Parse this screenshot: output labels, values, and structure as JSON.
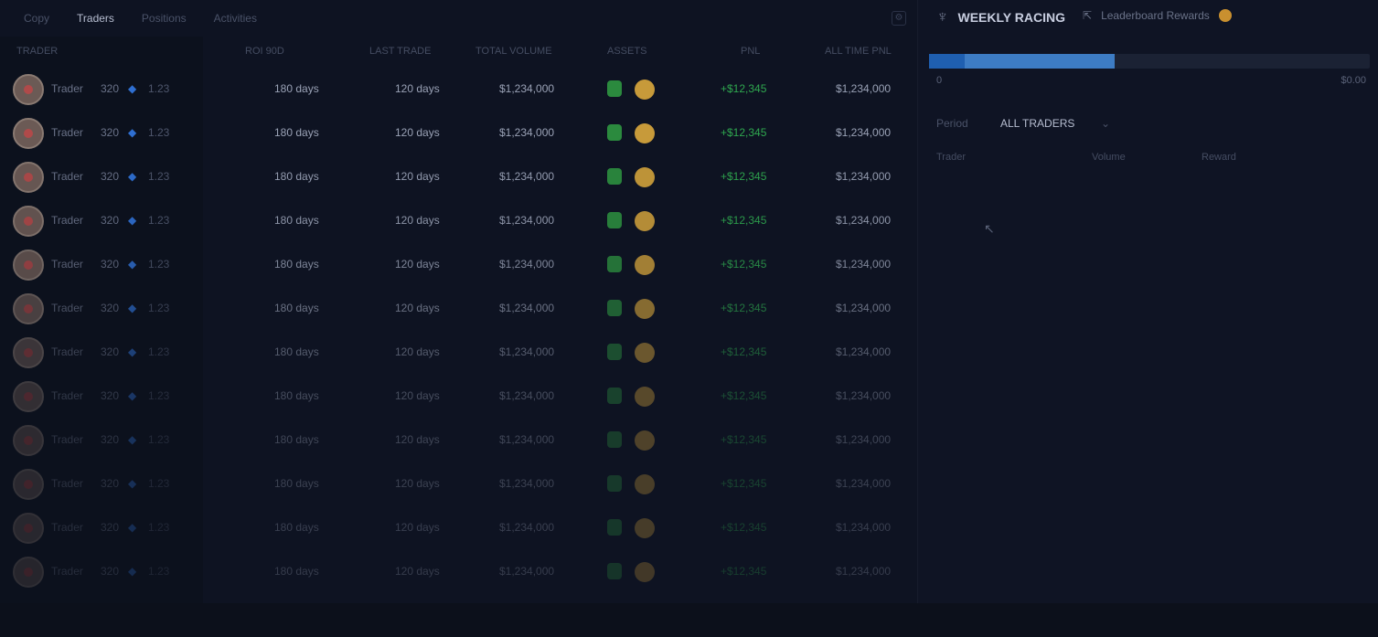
{
  "nav": {
    "tabs": [
      "Copy",
      "Traders",
      "Positions",
      "Activities"
    ],
    "active_index": 1
  },
  "table": {
    "headers": [
      "TRADER",
      "ROI 90D",
      "LAST TRADE",
      "TOTAL VOLUME",
      "ASSETS",
      "PNL",
      "ALL TIME PNL"
    ],
    "rows": [
      {
        "name": "Trader",
        "level": "320",
        "value": "1.23",
        "roi": "180 days",
        "last": "120 days",
        "volume": "$1,234,000",
        "pnl": "+$12,345",
        "alltime": "$1,234,000",
        "opacity": 1
      },
      {
        "name": "Trader",
        "level": "320",
        "value": "1.23",
        "roi": "180 days",
        "last": "120 days",
        "volume": "$1,234,000",
        "pnl": "+$12,345",
        "alltime": "$1,234,000",
        "opacity": 1
      },
      {
        "name": "Trader",
        "level": "320",
        "value": "1.23",
        "roi": "180 days",
        "last": "120 days",
        "volume": "$1,234,000",
        "pnl": "+$12,345",
        "alltime": "$1,234,000",
        "opacity": 0.95
      },
      {
        "name": "Trader",
        "level": "320",
        "value": "1.23",
        "roi": "180 days",
        "last": "120 days",
        "volume": "$1,234,000",
        "pnl": "+$12,345",
        "alltime": "$1,234,000",
        "opacity": 0.9
      },
      {
        "name": "Trader",
        "level": "320",
        "value": "1.23",
        "roi": "180 days",
        "last": "120 days",
        "volume": "$1,234,000",
        "pnl": "+$12,345",
        "alltime": "$1,234,000",
        "opacity": 0.8
      },
      {
        "name": "Trader",
        "level": "320",
        "value": "1.23",
        "roi": "180 days",
        "last": "120 days",
        "volume": "$1,234,000",
        "pnl": "+$12,345",
        "alltime": "$1,234,000",
        "opacity": 0.65
      },
      {
        "name": "Trader",
        "level": "320",
        "value": "1.23",
        "roi": "180 days",
        "last": "120 days",
        "volume": "$1,234,000",
        "pnl": "+$12,345",
        "alltime": "$1,234,000",
        "opacity": 0.5
      },
      {
        "name": "Trader",
        "level": "320",
        "value": "1.23",
        "roi": "180 days",
        "last": "120 days",
        "volume": "$1,234,000",
        "pnl": "+$12,345",
        "alltime": "$1,234,000",
        "opacity": 0.4
      },
      {
        "name": "Trader",
        "level": "320",
        "value": "1.23",
        "roi": "180 days",
        "last": "120 days",
        "volume": "$1,234,000",
        "pnl": "+$12,345",
        "alltime": "$1,234,000",
        "opacity": 0.35
      },
      {
        "name": "Trader",
        "level": "320",
        "value": "1.23",
        "roi": "180 days",
        "last": "120 days",
        "volume": "$1,234,000",
        "pnl": "+$12,345",
        "alltime": "$1,234,000",
        "opacity": 0.32
      },
      {
        "name": "Trader",
        "level": "320",
        "value": "1.23",
        "roi": "180 days",
        "last": "120 days",
        "volume": "$1,234,000",
        "pnl": "+$12,345",
        "alltime": "$1,234,000",
        "opacity": 0.3
      },
      {
        "name": "Trader",
        "level": "320",
        "value": "1.23",
        "roi": "180 days",
        "last": "120 days",
        "volume": "$1,234,000",
        "pnl": "+$12,345",
        "alltime": "$1,234,000",
        "opacity": 0.28
      }
    ]
  },
  "footer": {
    "items": [
      "",
      "",
      "",
      "",
      "",
      "",
      "",
      "",
      "",
      "",
      ""
    ]
  },
  "panel": {
    "title": "WEEKLY RACING",
    "subtitle": "Leaderboard Rewards",
    "tabs": [
      "",
      "",
      "",
      ""
    ],
    "progress": {
      "segment1": 0.08,
      "segment2": 0.42,
      "left_label": "0",
      "right_label": "$0.00"
    },
    "filter_label": "Period",
    "filter_value": "ALL TRADERS",
    "columns": [
      "Trader",
      "Volume",
      "Reward"
    ],
    "link": ""
  },
  "colors": {
    "accent_blue": "#2f6fd1",
    "pnl_green": "#2fa84f",
    "badge_green": "#2b8a3e",
    "badge_gold": "#c79a3a"
  }
}
